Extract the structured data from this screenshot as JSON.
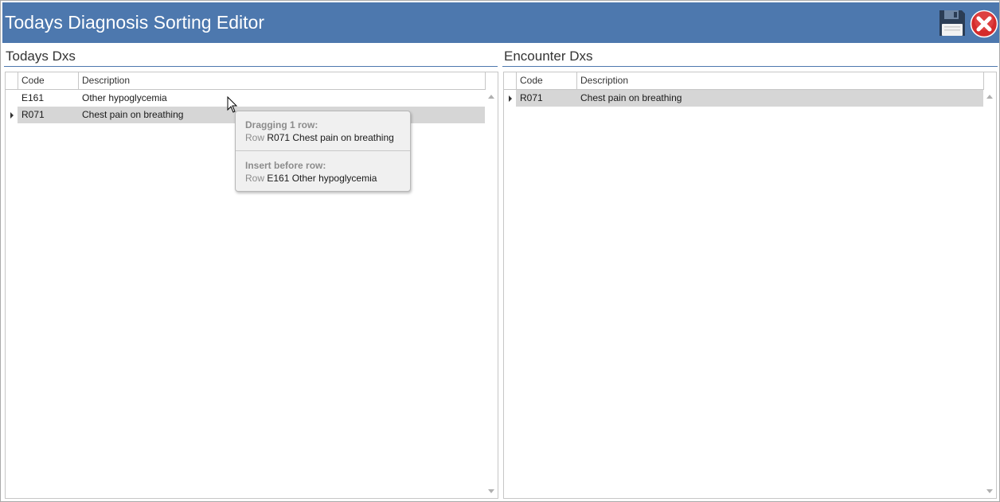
{
  "window": {
    "title": "Todays Diagnosis Sorting Editor",
    "save_icon": "floppy-disk-icon",
    "close_icon": "red-x-close-icon",
    "accent_color": "#4d78ae"
  },
  "left_panel": {
    "label": "Todays Dxs",
    "columns": {
      "code": "Code",
      "description": "Description"
    },
    "rows": [
      {
        "code": "E161",
        "description": "Other hypoglycemia",
        "selected": false
      },
      {
        "code": "R071",
        "description": "Chest pain on breathing",
        "selected": true
      }
    ]
  },
  "right_panel": {
    "label": "Encounter Dxs",
    "columns": {
      "code": "Code",
      "description": "Description"
    },
    "rows": [
      {
        "code": "R071",
        "description": "Chest pain on breathing",
        "selected": true
      }
    ]
  },
  "drag_tooltip": {
    "dragging_header": "Dragging 1 row:",
    "dragging_prefix": "Row",
    "dragging_value": "R071 Chest pain on breathing",
    "insert_header": "Insert before row:",
    "insert_prefix": "Row",
    "insert_value": "E161 Other hypoglycemia"
  }
}
